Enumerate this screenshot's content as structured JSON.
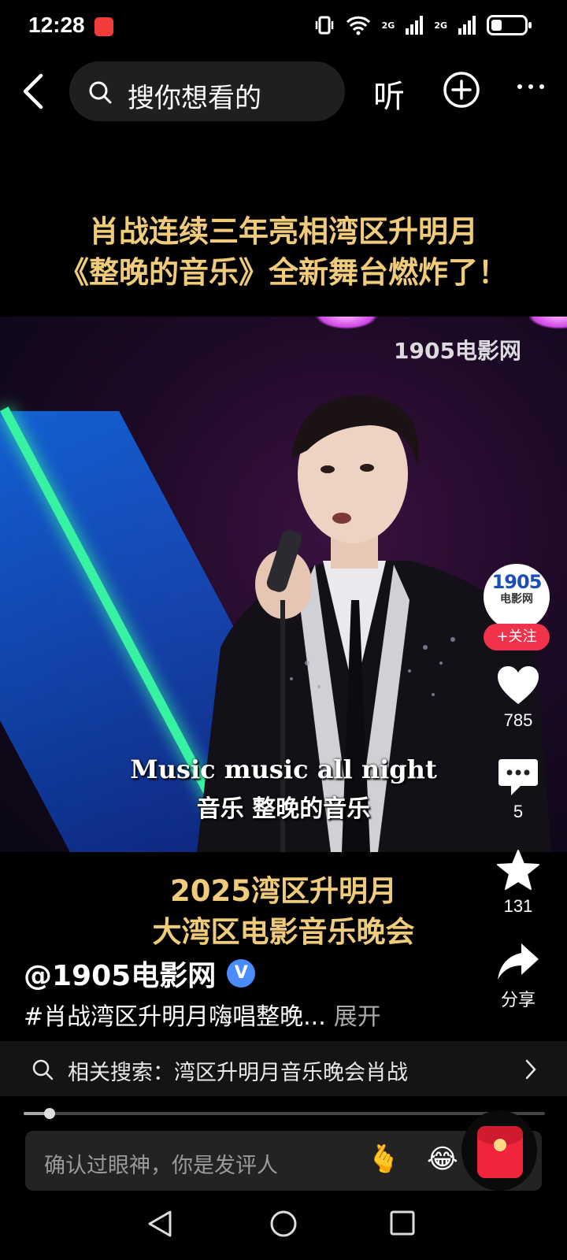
{
  "status_bar": {
    "time": "12:28",
    "signal1": "2G",
    "signal2": "2G"
  },
  "top_bar": {
    "search_placeholder": "搜你想看的",
    "listen_label": "听"
  },
  "video": {
    "headline_line1": "肖战连续三年亮相湾区升明月",
    "headline_line2": "《整晚的音乐》全新舞台燃炸了！",
    "watermark": "1905电影网",
    "subtitle_en": "Music music all night",
    "subtitle_cn": "音乐 整晚的音乐",
    "event_line1": "2025湾区升明月",
    "event_line2": "大湾区电影音乐晚会",
    "progress": 0.05
  },
  "actions": {
    "avatar_line1": "1905",
    "avatar_line2": "电影网",
    "follow_label": "+关注",
    "likes": "785",
    "comments": "5",
    "favorites": "131",
    "share_label": "分享"
  },
  "author": {
    "name": "@1905电影网",
    "verified_mark": "V",
    "caption": "#肖战湾区升明月嗨唱整晚...",
    "expand_label": "展开"
  },
  "related_search": {
    "text": "相关搜索：湾区升明月音乐晚会肖战"
  },
  "comment": {
    "placeholder": "确认过眼神，你是发评人",
    "emoji1": "🫰",
    "emoji2": "😂"
  }
}
